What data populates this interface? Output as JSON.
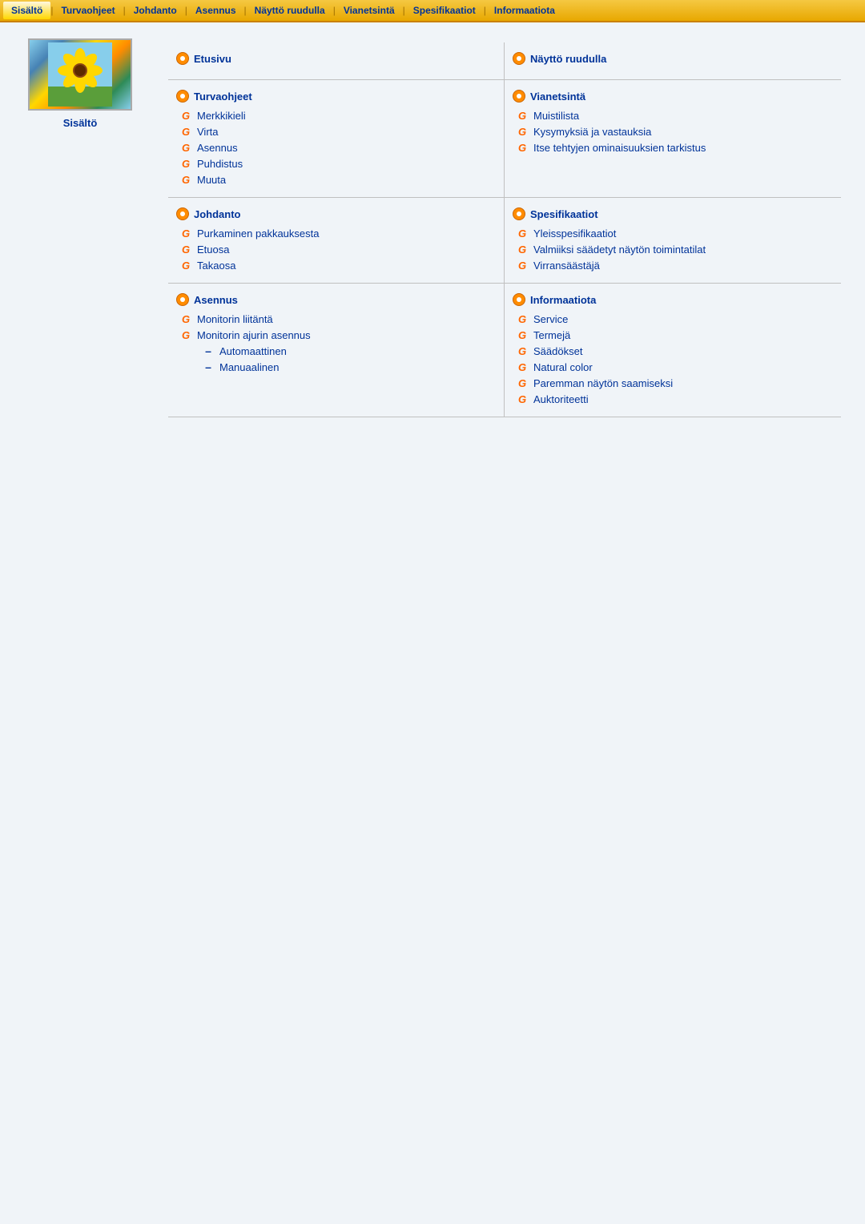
{
  "nav": {
    "items": [
      {
        "label": "Sisältö",
        "active": true
      },
      {
        "label": "Turvaohjeet",
        "active": false
      },
      {
        "label": "Johdanto",
        "active": false
      },
      {
        "label": "Asennus",
        "active": false
      },
      {
        "label": "Näyttö ruudulla",
        "active": false
      },
      {
        "label": "Vianetsintä",
        "active": false
      },
      {
        "label": "Spesifikaatiot",
        "active": false
      },
      {
        "label": "Informaatiota",
        "active": false
      }
    ]
  },
  "sidebar": {
    "label": "Sisältö"
  },
  "sections": [
    {
      "id": "etusivu",
      "title": "Etusivu",
      "icon": "circle",
      "items": []
    },
    {
      "id": "naytto-ruudulla",
      "title": "Näyttö ruudulla",
      "icon": "circle",
      "items": []
    },
    {
      "id": "turvaohjeet",
      "title": "Turvaohjeet",
      "icon": "circle",
      "items": [
        {
          "label": "Merkkikieli",
          "icon": "g",
          "sub": false
        },
        {
          "label": "Virta",
          "icon": "g",
          "sub": false
        },
        {
          "label": "Asennus",
          "icon": "g",
          "sub": false
        },
        {
          "label": "Puhdistus",
          "icon": "g",
          "sub": false
        },
        {
          "label": "Muuta",
          "icon": "g",
          "sub": false
        }
      ]
    },
    {
      "id": "vianetsinta",
      "title": "Vianetsintä",
      "icon": "circle",
      "items": [
        {
          "label": "Muistilista",
          "icon": "g",
          "sub": false
        },
        {
          "label": "Kysymyksiä ja vastauksia",
          "icon": "g",
          "sub": false
        },
        {
          "label": "Itse tehtyjen ominaisuuksien tarkistus",
          "icon": "g",
          "sub": false
        }
      ]
    },
    {
      "id": "johdanto",
      "title": "Johdanto",
      "icon": "circle",
      "items": [
        {
          "label": "Purkaminen pakkauksesta",
          "icon": "g",
          "sub": false
        },
        {
          "label": "Etuosa",
          "icon": "g",
          "sub": false
        },
        {
          "label": "Takaosa",
          "icon": "g",
          "sub": false
        }
      ]
    },
    {
      "id": "spesifikaatiot",
      "title": "Spesifikaatiot",
      "icon": "circle",
      "items": [
        {
          "label": "Yleisspesifikaatiot",
          "icon": "g",
          "sub": false
        },
        {
          "label": "Valmiiksi säädetyt näytön toimintatilat",
          "icon": "g",
          "sub": false
        },
        {
          "label": "Virransäästäjä",
          "icon": "g",
          "sub": false
        }
      ]
    },
    {
      "id": "asennus",
      "title": "Asennus",
      "icon": "circle",
      "items": [
        {
          "label": "Monitorin liitäntä",
          "icon": "g",
          "sub": false
        },
        {
          "label": "Monitorin ajurin asennus",
          "icon": "g",
          "sub": false
        },
        {
          "label": "Automaattinen",
          "icon": "dash",
          "sub": true
        },
        {
          "label": "Manuaalinen",
          "icon": "dash",
          "sub": true
        }
      ]
    },
    {
      "id": "informaatiota",
      "title": "Informaatiota",
      "icon": "circle",
      "items": [
        {
          "label": "Service",
          "icon": "g",
          "sub": false
        },
        {
          "label": "Termejä",
          "icon": "g",
          "sub": false
        },
        {
          "label": "Säädökset",
          "icon": "g",
          "sub": false
        },
        {
          "label": "Natural color",
          "icon": "g",
          "sub": false
        },
        {
          "label": "Paremman näytön saamiseksi",
          "icon": "g",
          "sub": false
        },
        {
          "label": "Auktoriteetti",
          "icon": "g",
          "sub": false
        }
      ]
    }
  ]
}
